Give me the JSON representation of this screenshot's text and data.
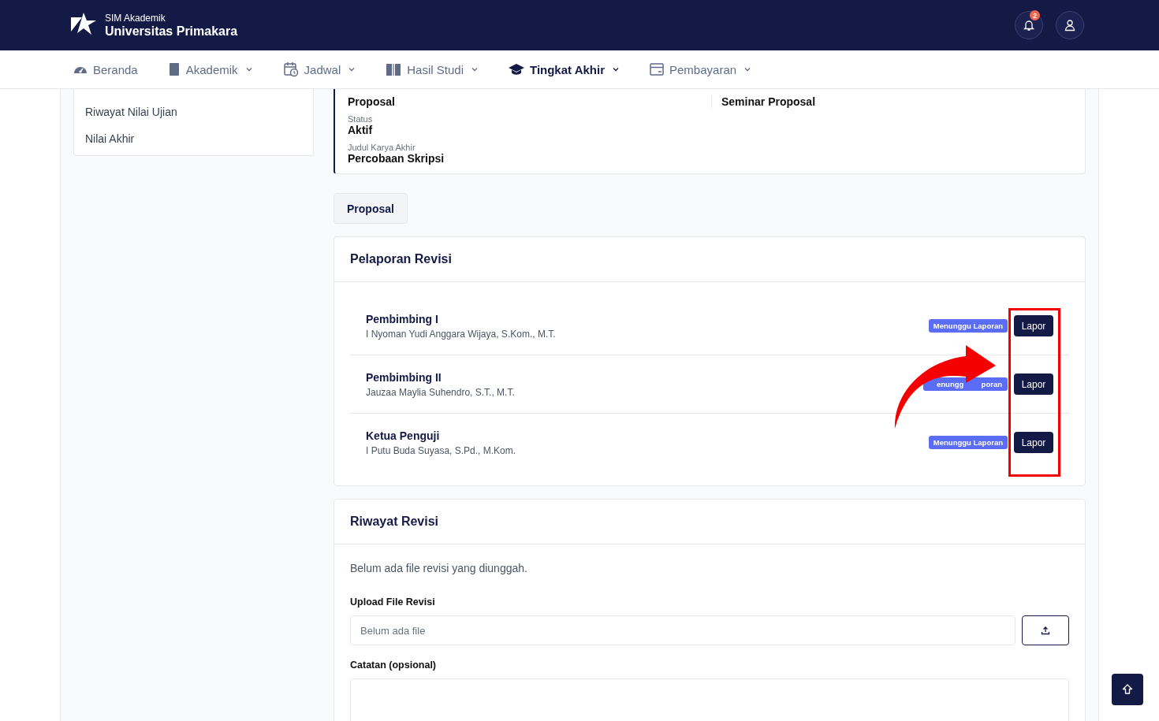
{
  "header": {
    "app_name": "SIM Akademik",
    "university": "Universitas Primakara",
    "notification_count": "2"
  },
  "nav": [
    {
      "label": "Beranda",
      "dropdown": false,
      "selected": false
    },
    {
      "label": "Akademik",
      "dropdown": true,
      "selected": false
    },
    {
      "label": "Jadwal",
      "dropdown": true,
      "selected": false
    },
    {
      "label": "Hasil Studi",
      "dropdown": true,
      "selected": false
    },
    {
      "label": "Tingkat Akhir",
      "dropdown": true,
      "selected": true
    },
    {
      "label": "Pembayaran",
      "dropdown": true,
      "selected": false
    }
  ],
  "sidebar": {
    "items": [
      "Riwayat Nilai Ujian",
      "Nilai Akhir"
    ]
  },
  "info": {
    "left": [
      {
        "value": "Proposal"
      },
      {
        "label": "Status",
        "value": "Aktif"
      },
      {
        "label": "Judul Karya Akhir",
        "value": "Percobaan Skripsi"
      }
    ],
    "right": [
      {
        "value": "Seminar Proposal"
      }
    ]
  },
  "stage_tabs": [
    {
      "label": "Proposal",
      "selected": true
    }
  ],
  "report": {
    "title": "Pelaporan Revisi",
    "rows": [
      {
        "role": "Pembimbing I",
        "name": "I Nyoman Yudi Anggara Wijaya, S.Kom., M.T.",
        "status": "Menunggu Laporan",
        "action": "Lapor"
      },
      {
        "role": "Pembimbing II",
        "name": "Jauzaa Maylia Suhendro, S.T., M.T.",
        "status_visible": [
          "enungg",
          "poran"
        ],
        "action": "Lapor"
      },
      {
        "role": "Ketua Penguji",
        "name": "I Putu Buda Suyasa, S.Pd., M.Kom.",
        "status": "Menunggu Laporan",
        "action": "Lapor"
      }
    ]
  },
  "history": {
    "title": "Riwayat Revisi",
    "empty_text": "Belum ada file revisi yang diunggah.",
    "upload_label": "Upload File Revisi",
    "upload_placeholder": "Belum ada file",
    "notes_label": "Catatan (opsional)"
  }
}
